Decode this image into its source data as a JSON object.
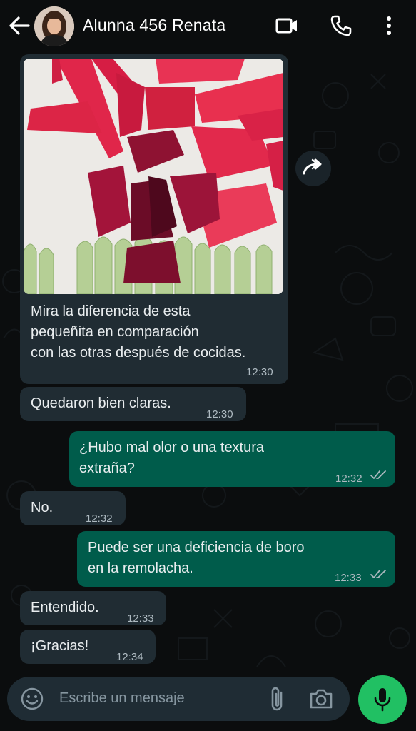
{
  "header": {
    "contact_name": "Alunna 456 Renata",
    "icons": [
      "back-arrow-icon",
      "video-call-icon",
      "phone-call-icon",
      "more-options-icon"
    ]
  },
  "messages": [
    {
      "id": "m1",
      "direction": "incoming",
      "has_image": true,
      "text_lines": [
        "Mira la diferencia de esta",
        "pequeñita en comparación",
        "con las otras después de cocidas."
      ],
      "time": "12:30"
    },
    {
      "id": "m2",
      "direction": "incoming",
      "text": "Quedaron bien claras.",
      "time": "12:30"
    },
    {
      "id": "m3",
      "direction": "outgoing",
      "text_lines": [
        "¿Hubo mal olor o una textura",
        "extraña?"
      ],
      "time": "12:32",
      "status": "read"
    },
    {
      "id": "m4",
      "direction": "incoming",
      "text": "No.",
      "time": "12:32"
    },
    {
      "id": "m5",
      "direction": "outgoing",
      "text_lines": [
        "Puede ser una deficiencia de boro",
        "en la remolacha."
      ],
      "time": "12:33",
      "status": "read"
    },
    {
      "id": "m6",
      "direction": "incoming",
      "text": "Entendido.",
      "time": "12:33"
    },
    {
      "id": "m7",
      "direction": "incoming",
      "text": "¡Gracias!",
      "time": "12:34"
    }
  ],
  "composer": {
    "placeholder": "Escribe un mensaje",
    "icons": [
      "emoji-icon",
      "attach-icon",
      "camera-icon",
      "microphone-icon"
    ]
  },
  "colors": {
    "background": "#0b0d0e",
    "incoming_bubble": "#202c33",
    "outgoing_bubble": "#005c4b",
    "mic_button": "#21c063",
    "read_ticks": "#aebac1"
  }
}
